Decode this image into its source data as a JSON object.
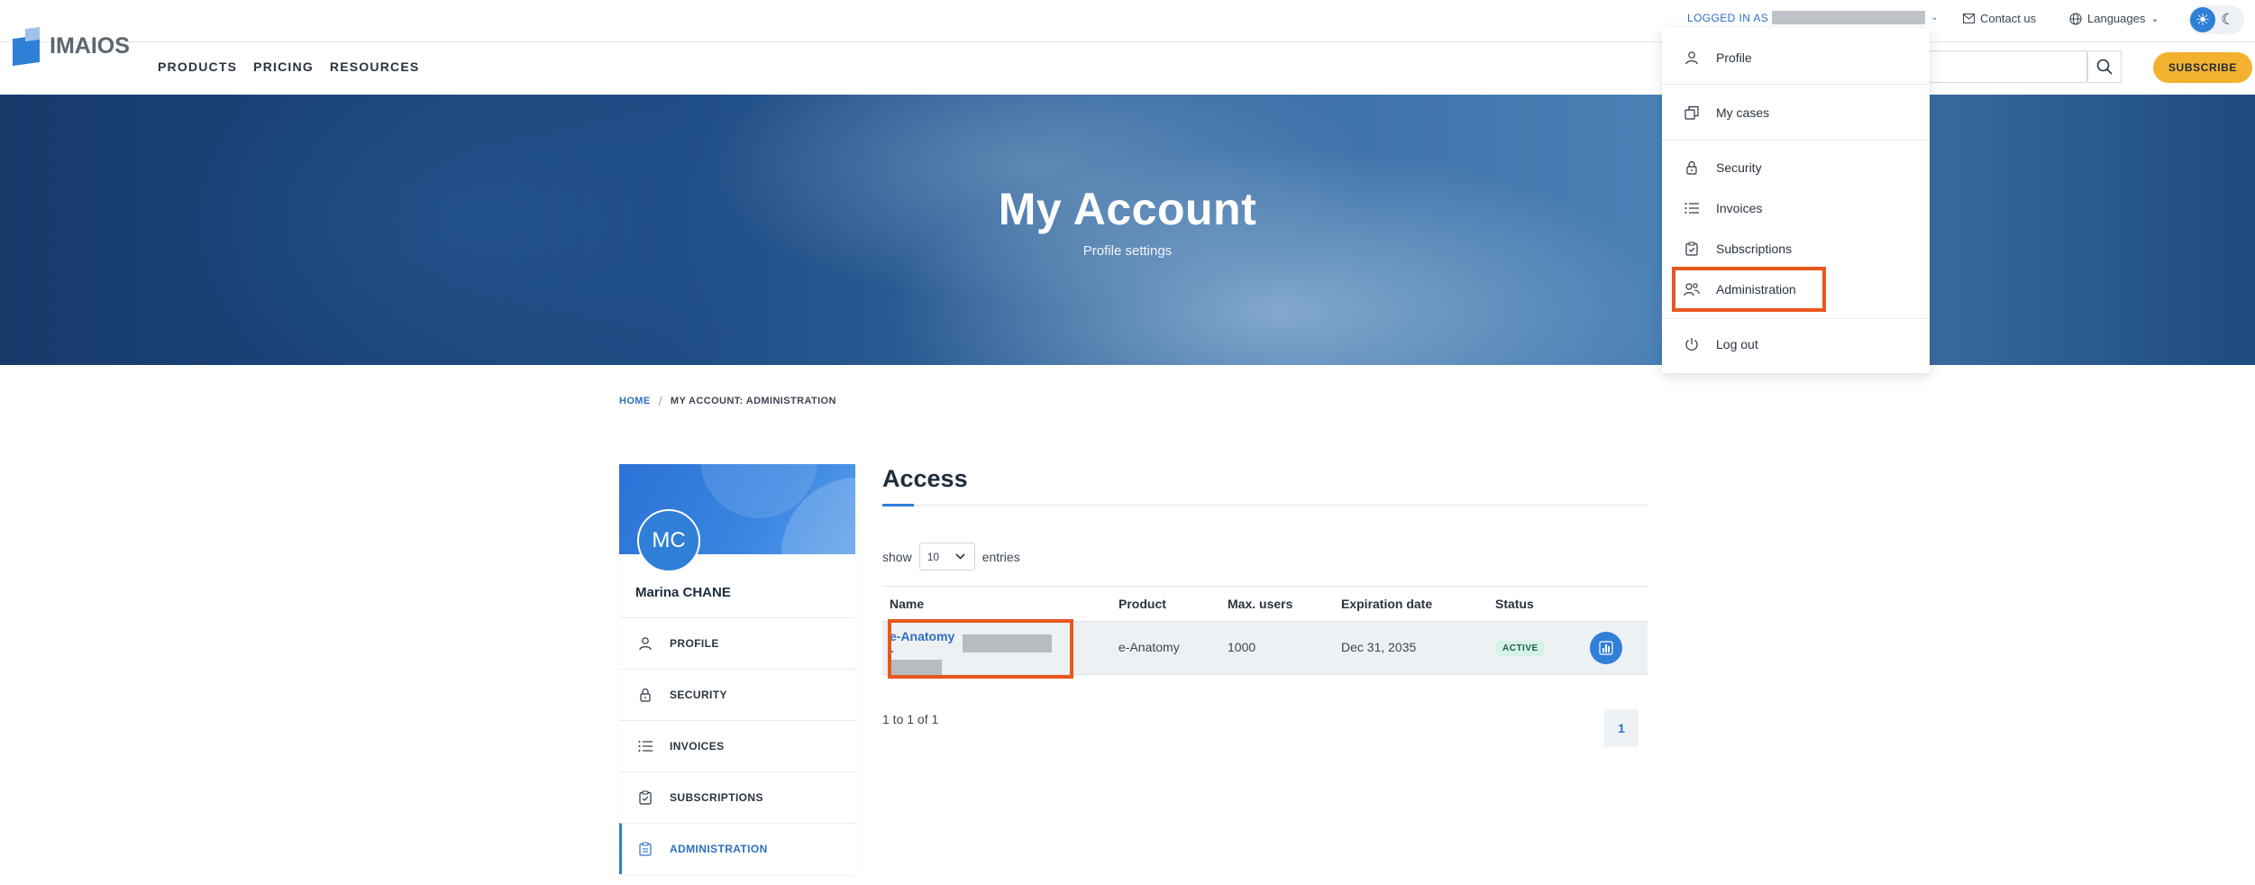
{
  "header": {
    "logo_text": "IMAIOS",
    "nav": [
      "PRODUCTS",
      "PRICING",
      "RESOURCES"
    ],
    "logged_in_label": "LOGGED IN AS",
    "contact_label": "Contact us",
    "languages_label": "Languages",
    "subscribe_label": "SUBSCRIBE"
  },
  "hero": {
    "title": "My Account",
    "subtitle": "Profile settings"
  },
  "breadcrumb": {
    "home": "HOME",
    "separator": "/",
    "current": "MY ACCOUNT: ADMINISTRATION"
  },
  "sidebar": {
    "initials": "MC",
    "name": "Marina CHANE",
    "items": [
      {
        "label": "PROFILE",
        "icon": "user-icon"
      },
      {
        "label": "SECURITY",
        "icon": "lock-icon"
      },
      {
        "label": "INVOICES",
        "icon": "list-icon"
      },
      {
        "label": "SUBSCRIPTIONS",
        "icon": "clipboard-check-icon"
      },
      {
        "label": "ADMINISTRATION",
        "icon": "clipboard-list-icon",
        "active": true
      }
    ]
  },
  "main": {
    "title": "Access",
    "show_label": "show",
    "show_value": "10",
    "entries_label": "entries",
    "columns": [
      "Name",
      "Product",
      "Max. users",
      "Expiration date",
      "Status"
    ],
    "rows": [
      {
        "name": "e-Anatomy -",
        "product": "e-Anatomy",
        "max_users": "1000",
        "expiration": "Dec 31, 2035",
        "status": "ACTIVE"
      }
    ],
    "pager_info": "1 to 1 of 1",
    "current_page": "1"
  },
  "dropdown": {
    "items": [
      "Profile",
      "My cases",
      "Security",
      "Invoices",
      "Subscriptions",
      "Administration",
      "Log out"
    ]
  },
  "colors": {
    "accent": "#2f7fd6",
    "link": "#2d6fc0",
    "subscribe": "#f2b230",
    "highlight": "#e8571d",
    "status_bg": "#d6f2e6"
  }
}
